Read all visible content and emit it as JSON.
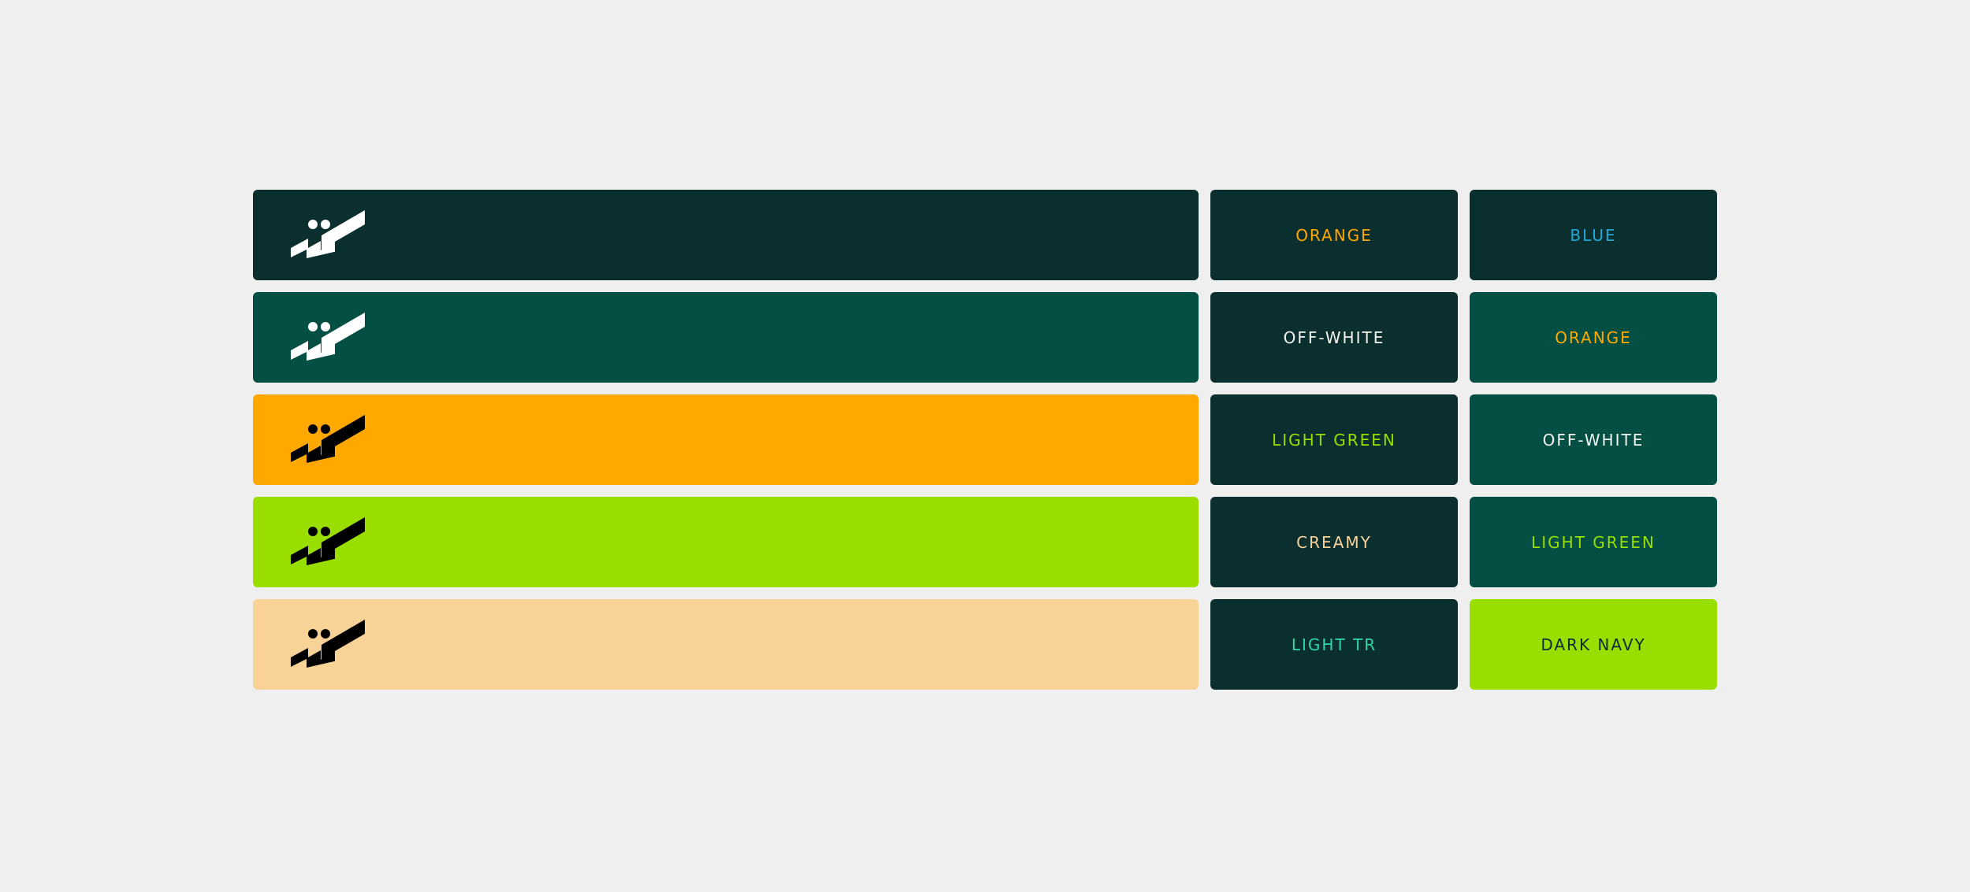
{
  "colors": {
    "page_bg": "#efefef",
    "dark_navy": "#0b2e2f",
    "dark_green": "#034f43",
    "orange": "#ffa800",
    "light_green": "#9ade00",
    "creamy": "#f8d297",
    "off_white": "#f4f4ef",
    "blue": "#22a7d6",
    "light_tr": "#2fd6a6",
    "black": "#000000"
  },
  "rows": [
    {
      "bar_color": "#0b2e2f",
      "logo_color": "#ffffff",
      "logo_icon": "brand-logo-icon",
      "swatches": [
        {
          "label": "ORANGE",
          "bg": "#0b2e2f",
          "fg": "#ffa800"
        },
        {
          "label": "BLUE",
          "bg": "#0b2e2f",
          "fg": "#22a7d6"
        }
      ]
    },
    {
      "bar_color": "#034f43",
      "logo_color": "#ffffff",
      "logo_icon": "brand-logo-icon",
      "swatches": [
        {
          "label": "OFF-WHITE",
          "bg": "#0b2e2f",
          "fg": "#f4f4ef"
        },
        {
          "label": "ORANGE",
          "bg": "#034f43",
          "fg": "#ffa800"
        }
      ]
    },
    {
      "bar_color": "#ffa800",
      "logo_color": "#000000",
      "logo_icon": "brand-logo-icon",
      "swatches": [
        {
          "label": "LIGHT GREEN",
          "bg": "#0b2e2f",
          "fg": "#9ade00"
        },
        {
          "label": "OFF-WHITE",
          "bg": "#034f43",
          "fg": "#f4f4ef"
        }
      ]
    },
    {
      "bar_color": "#9ade00",
      "logo_color": "#000000",
      "logo_icon": "brand-logo-icon",
      "swatches": [
        {
          "label": "CREAMY",
          "bg": "#0b2e2f",
          "fg": "#f8d297"
        },
        {
          "label": "LIGHT GREEN",
          "bg": "#034f43",
          "fg": "#9ade00"
        }
      ]
    },
    {
      "bar_color": "#f8d297",
      "logo_color": "#000000",
      "logo_icon": "brand-logo-icon",
      "swatches": [
        {
          "label": "LIGHT TR",
          "bg": "#0b2e2f",
          "fg": "#2fd6a6"
        },
        {
          "label": "DARK NAVY",
          "bg": "#9ade00",
          "fg": "#0b2e2f"
        }
      ]
    }
  ]
}
